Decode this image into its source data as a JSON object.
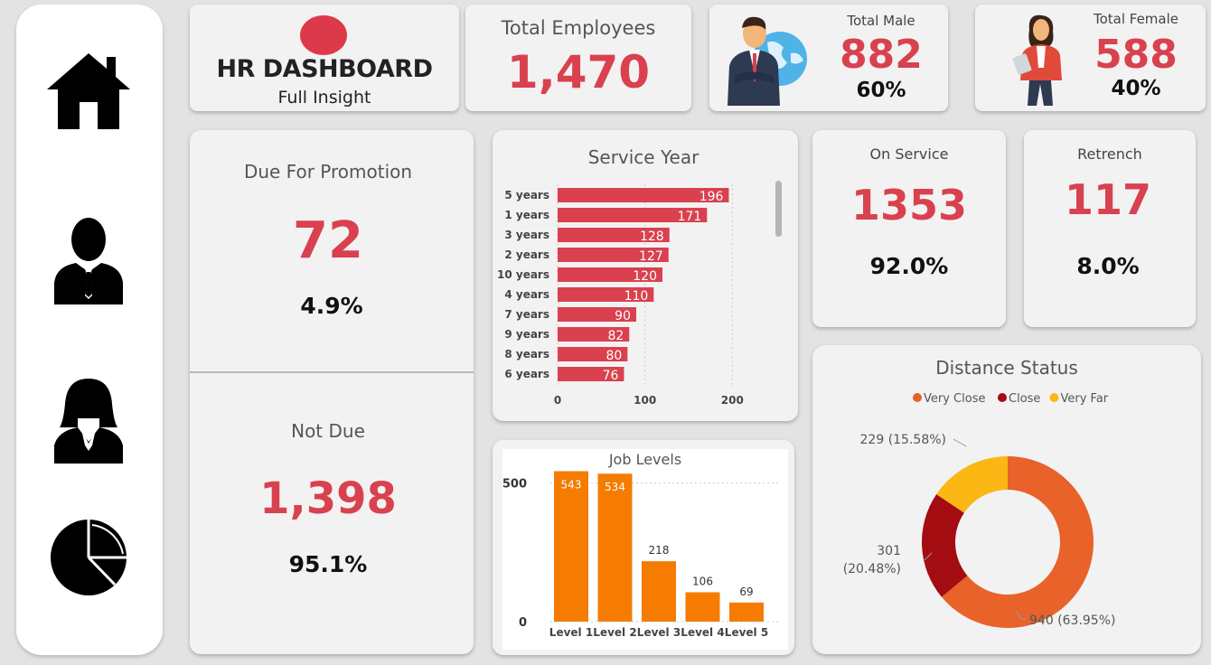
{
  "header": {
    "title": "HR DASHBOARD",
    "subtitle": "Full Insight"
  },
  "nav": {
    "items": [
      "home-icon",
      "male-user-icon",
      "female-user-icon",
      "pie-chart-icon"
    ]
  },
  "kpis": {
    "total_employees": {
      "label": "Total Employees",
      "value": "1,470"
    },
    "total_male": {
      "label": "Total Male",
      "value": "882",
      "pct": "60%"
    },
    "total_female": {
      "label": "Total Female",
      "value": "588",
      "pct": "40%"
    },
    "due_promotion": {
      "label": "Due For Promotion",
      "value": "72",
      "pct": "4.9%"
    },
    "not_due": {
      "label": "Not Due",
      "value": "1,398",
      "pct": "95.1%"
    },
    "on_service": {
      "label": "On Service",
      "value": "1353",
      "pct": "92.0%"
    },
    "retrench": {
      "label": "Retrench",
      "value": "117",
      "pct": "8.0%"
    }
  },
  "colors": {
    "accent_red": "#d9414f",
    "orange": "#f57c00",
    "donut_very_close": "#e8622a",
    "donut_close": "#a30d12",
    "donut_very_far": "#fbb714"
  },
  "chart_data": [
    {
      "type": "bar",
      "orientation": "horizontal",
      "title": "Service Year",
      "categories": [
        "5 years",
        "1 years",
        "3 years",
        "2 years",
        "10 years",
        "4 years",
        "7 years",
        "9 years",
        "8 years",
        "6 years"
      ],
      "values": [
        196,
        171,
        128,
        127,
        120,
        110,
        90,
        82,
        80,
        76
      ],
      "xticks": [
        "0",
        "100",
        "200"
      ],
      "xlim": [
        0,
        210
      ]
    },
    {
      "type": "bar",
      "title": "Job Levels",
      "categories": [
        "Level 1",
        "Level 2",
        "Level 3",
        "Level 4",
        "Level 5"
      ],
      "values": [
        543,
        534,
        218,
        106,
        69
      ],
      "yticks": [
        "0",
        "500"
      ],
      "ylim": [
        0,
        600
      ]
    },
    {
      "type": "pie",
      "donut": true,
      "title": "Distance Status",
      "legend": [
        "Very Close",
        "Close",
        "Very Far"
      ],
      "values": [
        940,
        301,
        229
      ],
      "labels": [
        "940 (63.95%)",
        "301 (20.48%)",
        "229 (15.58%)"
      ]
    }
  ]
}
